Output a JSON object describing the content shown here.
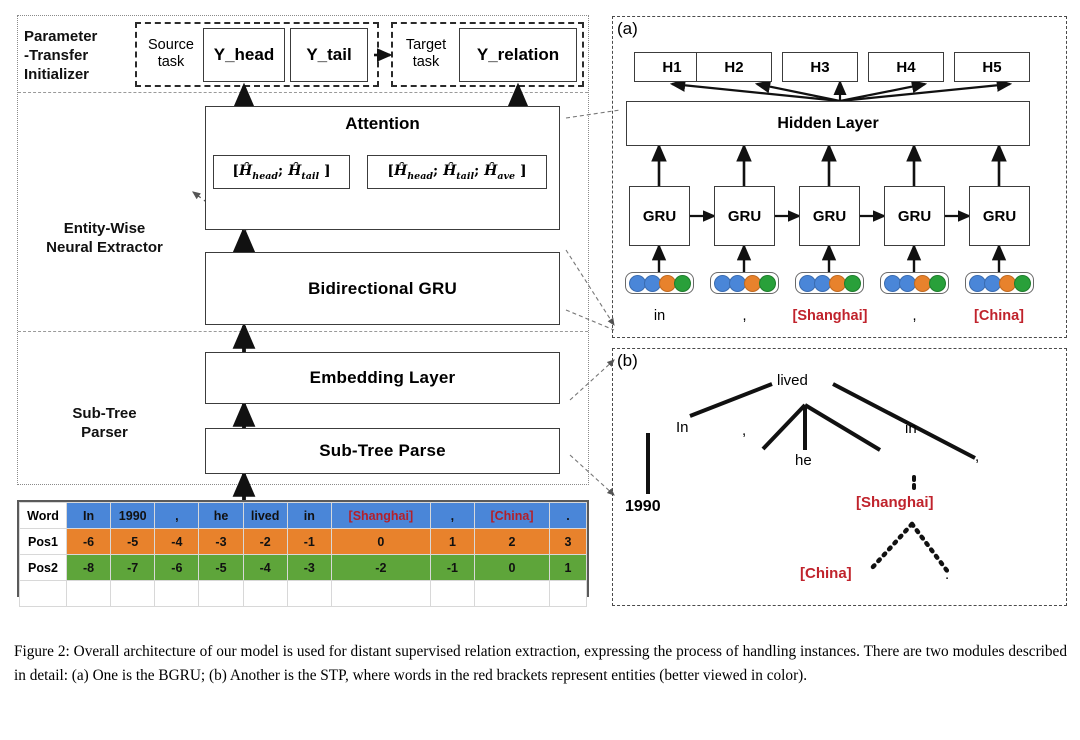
{
  "figure": {
    "caption": "Figure 2: Overall architecture of our model is used for distant supervised relation extraction, expressing the process of handling instances.  There are two modules described in detail: (a) One is the BGRU; (b) Another is the STP, where words in the red brackets represent entities (better viewed in color)."
  },
  "colors": {
    "word_row": "#4a86d8",
    "pos1_row": "#e8822c",
    "pos2_row": "#5ea53a",
    "entity_red": "#c0232c",
    "box_border": "#3c3c3c"
  },
  "left_architecture": {
    "stages": [
      {
        "id": "parameter-transfer-initializer",
        "label": "Parameter\n-Transfer\nInitializer",
        "lines": [
          "Parameter",
          "-Transfer",
          "Initializer"
        ]
      },
      {
        "id": "entity-wise-neural-extractor",
        "label": "Entity-Wise\nNeural Extractor",
        "lines": [
          "Entity-Wise",
          "Neural Extractor"
        ]
      },
      {
        "id": "sub-tree-parser",
        "label": "Sub-Tree\nParser",
        "lines": [
          "Sub-Tree",
          "Parser"
        ]
      }
    ],
    "transfer": {
      "source_task_label_line1": "Source",
      "source_task_label_line2": "task",
      "target_task_label_line1": "Target",
      "target_task_label_line2": "task",
      "outputs": [
        {
          "id": "y-head",
          "label": "Y_head"
        },
        {
          "id": "y-tail",
          "label": "Y_tail"
        },
        {
          "id": "y-relation",
          "label": "Y_relation"
        }
      ]
    },
    "attention": {
      "title": "Attention",
      "vectors": [
        {
          "id": "vector-head-tail",
          "text": "[Ĥhead; Ĥtail]",
          "parts": [
            "H",
            "head",
            "H",
            "tail"
          ]
        },
        {
          "id": "vector-head-tail-ave",
          "text": "[Ĥhead; Ĥtail; Ĥave]",
          "parts": [
            "H",
            "head",
            "H",
            "tail",
            "H",
            "ave"
          ]
        }
      ]
    },
    "layers": [
      {
        "id": "bidirectional-gru",
        "label": "Bidirectional GRU"
      },
      {
        "id": "embedding-layer",
        "label": "Embedding Layer"
      },
      {
        "id": "sub-tree-parse",
        "label": "Sub-Tree Parse"
      }
    ]
  },
  "word_table": {
    "row_labels": [
      "Word",
      "Pos1",
      "Pos2"
    ],
    "words": [
      "In",
      "1990",
      ",",
      "he",
      "lived",
      "in",
      "[Shanghai]",
      ",",
      "[China]",
      "."
    ],
    "entity_flags": [
      false,
      false,
      false,
      false,
      false,
      false,
      true,
      false,
      true,
      false
    ],
    "pos1": [
      "-6",
      "-5",
      "-4",
      "-3",
      "-2",
      "-1",
      "0",
      "1",
      "2",
      "3"
    ],
    "pos2": [
      "-8",
      "-7",
      "-6",
      "-5",
      "-4",
      "-3",
      "-2",
      "-1",
      "0",
      "1"
    ]
  },
  "panel_a": {
    "tag": "(a)",
    "hidden_states": [
      "H1",
      "H2",
      "H3",
      "H4",
      "H5"
    ],
    "hidden_layer_label": "Hidden Layer",
    "gru_label": "GRU",
    "gru_count": 5,
    "embedding_dots": [
      "blue",
      "blue",
      "orange",
      "green"
    ],
    "tokens": [
      {
        "text": "in",
        "entity": false
      },
      {
        "text": ",",
        "entity": false
      },
      {
        "text": "[Shanghai]",
        "entity": true
      },
      {
        "text": ",",
        "entity": false
      },
      {
        "text": "[China]",
        "entity": true
      }
    ]
  },
  "panel_b": {
    "tag": "(b)",
    "nodes": [
      {
        "id": "node-lived",
        "text": "lived",
        "entity": false
      },
      {
        "id": "node-in-cap",
        "text": "In",
        "entity": false
      },
      {
        "id": "node-comma-1",
        "text": ",",
        "entity": false
      },
      {
        "id": "node-he",
        "text": "he",
        "entity": false
      },
      {
        "id": "node-in",
        "text": "in",
        "entity": false
      },
      {
        "id": "node-comma-2",
        "text": ",",
        "entity": false
      },
      {
        "id": "node-1990",
        "text": "1990",
        "entity": false
      },
      {
        "id": "node-shanghai",
        "text": "[Shanghai]",
        "entity": true
      },
      {
        "id": "node-china",
        "text": "[China]",
        "entity": true
      },
      {
        "id": "node-period",
        "text": ".",
        "entity": false
      }
    ]
  }
}
